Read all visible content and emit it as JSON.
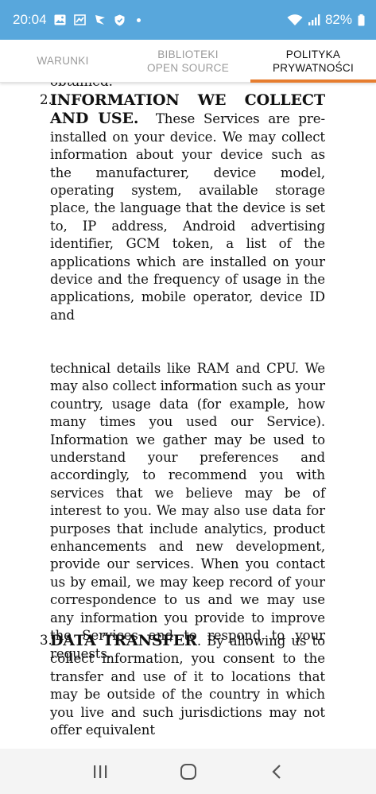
{
  "status_bar": {
    "time": "20:04",
    "battery": "82%",
    "icons_left": [
      "image-icon",
      "gallery-icon",
      "flag-icon",
      "shield-icon"
    ],
    "icons_right": [
      "wifi-icon",
      "signal-icon",
      "battery-icon"
    ]
  },
  "tabs": [
    {
      "label": "WARUNKI",
      "active": false
    },
    {
      "label": "BIBLIOTEKI OPEN SOURCE",
      "active": false
    },
    {
      "label": "POLITYKA PRYWATNOŚCI",
      "active": true
    }
  ],
  "accent_color": "#e67d2f",
  "document": {
    "cut_off_top": "obtained.",
    "section2": {
      "number": "2.",
      "heading": "INFORMATION WE COLLECT AND USE.",
      "body_part1": "These Services are pre-installed on your device. We may collect information about your device such as the manufacturer, device model, operating system, available storage place, the language that the device is set to, IP address, Android advertising identifier, GCM token, a list of the applications which are installed on your device and the frequency of usage in the applications, mobile operator, device ID and",
      "body_part2": "technical details like RAM and CPU. We may also collect information such as your country, usage data (for example, how many times you used our Service). Information we gather may be used to understand your preferences and accordingly, to recommend you with services that we believe may be of interest to you. We may also use data for purposes that include analytics, product enhancements and new development, provide our services. When you contact us by email, we may keep record of your correspondence to us and we may use any information you provide to improve the Services and to respond to your requests."
    },
    "section3": {
      "number": "3.",
      "heading": "DATA TRANSFER",
      "body": ". By allowing us to collect information, you consent to the transfer and use of it to locations that may be outside of the country in which you live and such jurisdictions may not offer equivalent"
    }
  },
  "nav_bar": {
    "buttons": [
      "recents-button",
      "home-button",
      "back-button"
    ]
  }
}
